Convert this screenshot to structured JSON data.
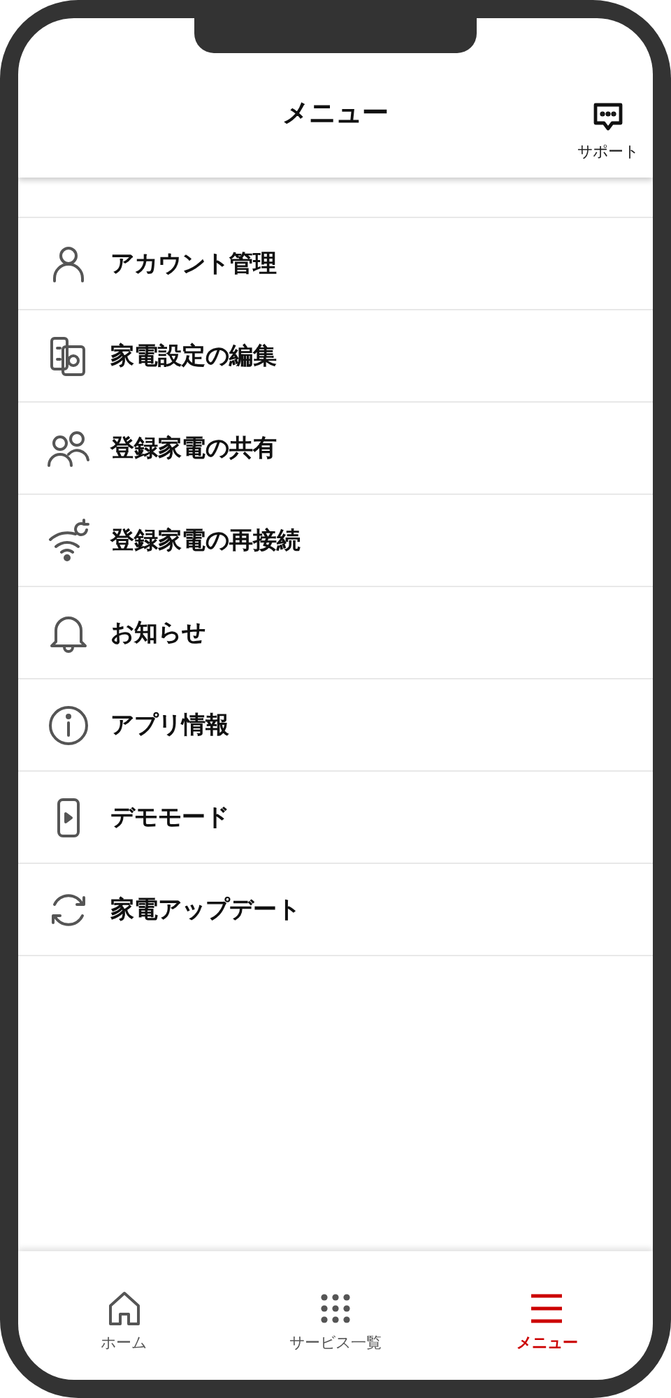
{
  "header": {
    "title": "メニュー",
    "support": {
      "label": "サポート"
    }
  },
  "menu": [
    {
      "kind": "account",
      "label": "アカウント管理"
    },
    {
      "kind": "appliance",
      "label": "家電設定の編集"
    },
    {
      "kind": "share",
      "label": "登録家電の共有"
    },
    {
      "kind": "reconnect",
      "label": "登録家電の再接続"
    },
    {
      "kind": "notice",
      "label": "お知らせ"
    },
    {
      "kind": "info",
      "label": "アプリ情報"
    },
    {
      "kind": "demo",
      "label": "デモモード"
    },
    {
      "kind": "update",
      "label": "家電アップデート"
    }
  ],
  "tabs": [
    {
      "kind": "home",
      "label": "ホーム",
      "selected": false
    },
    {
      "kind": "services",
      "label": "サービス一覧",
      "selected": false
    },
    {
      "kind": "menu",
      "label": "メニュー",
      "selected": true
    }
  ]
}
